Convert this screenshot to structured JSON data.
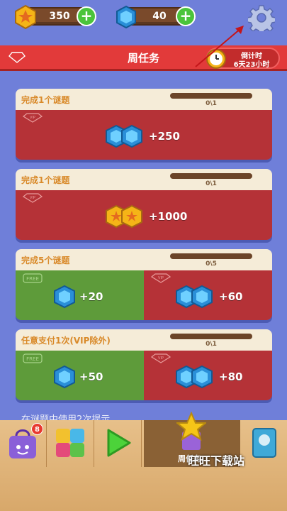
{
  "currency": {
    "stars": "350",
    "gems": "40"
  },
  "header": {
    "title": "周任务",
    "vip": "VIP",
    "timer_label": "倒计时",
    "timer_value": "6天23小时"
  },
  "tasks": [
    {
      "name": "完成1个谜题",
      "progress": "0\\1",
      "rewards": [
        {
          "tier": "VIP",
          "icon": "gem-pair-icon",
          "amount": "+250"
        }
      ]
    },
    {
      "name": "完成1个谜题",
      "progress": "0\\1",
      "rewards": [
        {
          "tier": "VIP",
          "icon": "star-coin-pair-icon",
          "amount": "+1000"
        }
      ]
    },
    {
      "name": "完成5个谜题",
      "progress": "0\\5",
      "rewards": [
        {
          "tier": "FREE",
          "icon": "gem-icon",
          "amount": "+20"
        },
        {
          "tier": "VIP",
          "icon": "gem-pair-icon",
          "amount": "+60"
        }
      ]
    },
    {
      "name": "任意支付1次(VIP除外)",
      "progress": "0\\1",
      "rewards": [
        {
          "tier": "FREE",
          "icon": "gem-icon",
          "amount": "+50"
        },
        {
          "tier": "VIP",
          "icon": "gem-pair-icon",
          "amount": "+80"
        }
      ]
    }
  ],
  "next_task_peek": "在谜题中使用2次提示",
  "bottom_nav": {
    "badge_count": "8",
    "active_label": "周任务",
    "watermark": "旺旺下载站"
  },
  "colors": {
    "background": "#6f7fd9",
    "banner": "#e23a3a",
    "vip_card": "#b53237",
    "free_card": "#5e9b3a",
    "card_header": "#f5ecd8"
  }
}
